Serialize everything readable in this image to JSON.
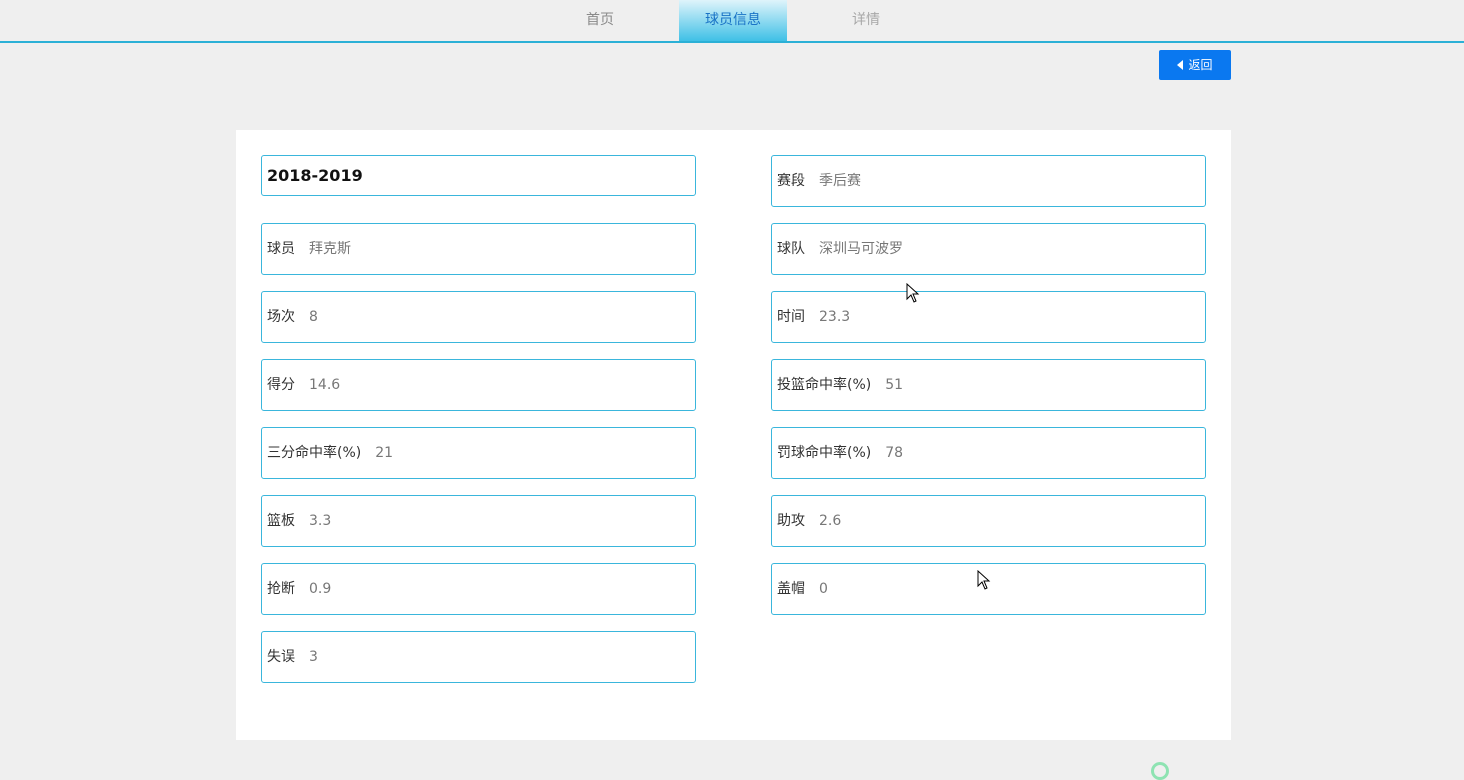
{
  "nav": {
    "tabs": [
      {
        "label": "首页"
      },
      {
        "label": "球员信息"
      },
      {
        "label": "详情"
      }
    ],
    "active_tab": "球员信息"
  },
  "back_button": {
    "label": "返回"
  },
  "player": {
    "season": "2018-2019",
    "fields": {
      "stage": {
        "label": "赛段",
        "value": "季后赛"
      },
      "player": {
        "label": "球员",
        "value": "拜克斯"
      },
      "team": {
        "label": "球队",
        "value": "深圳马可波罗"
      },
      "games": {
        "label": "场次",
        "value": "8"
      },
      "minutes": {
        "label": "时间",
        "value": "23.3"
      },
      "points": {
        "label": "得分",
        "value": "14.6"
      },
      "fg_pct": {
        "label": "投篮命中率(%)",
        "value": "51"
      },
      "three_pct": {
        "label": "三分命中率(%)",
        "value": "21"
      },
      "ft_pct": {
        "label": "罚球命中率(%)",
        "value": "78"
      },
      "rebounds": {
        "label": "篮板",
        "value": "3.3"
      },
      "assists": {
        "label": "助攻",
        "value": "2.6"
      },
      "steals": {
        "label": "抢断",
        "value": "0.9"
      },
      "blocks": {
        "label": "盖帽",
        "value": "0"
      },
      "turnovers": {
        "label": "失误",
        "value": "3"
      }
    }
  },
  "colors": {
    "accent": "#3ab6dc",
    "button": "#0a78f0",
    "background": "#efefef"
  },
  "icons": {
    "back": "caret-left-icon"
  }
}
